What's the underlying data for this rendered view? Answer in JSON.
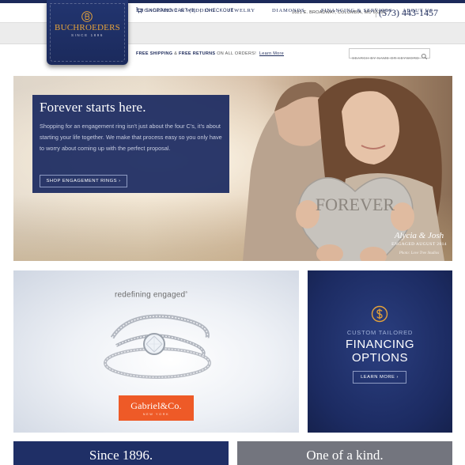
{
  "header": {
    "cart_label": "SHOPPING CART (0)",
    "checkout_label": "CHECKOUT",
    "address": "1021 E. BROADWAY, COLUMBIA, MO 65201",
    "phone": "(573) 443-1457"
  },
  "logo": {
    "name": "BUCHROEDERS",
    "since": "SINCE 1896",
    "accent_color": "#e6a33a"
  },
  "nav": {
    "items": [
      {
        "label": "ENGAGEMENT & WEDDING"
      },
      {
        "label": "JEWELRY"
      },
      {
        "label": "DIAMONDS"
      },
      {
        "label": "FINANCING & SERVICES"
      },
      {
        "label": "ABOUT US"
      }
    ]
  },
  "promo": {
    "shipping": "FREE SHIPPING",
    "amp": "&",
    "returns": "FREE RETURNS",
    "rest": "ON ALL ORDERS!",
    "link": "Learn More"
  },
  "search": {
    "placeholder": "SEARCH BY NAME OR KEYWORD"
  },
  "hero": {
    "title": "Forever starts here.",
    "body": "Shopping for an engagement ring isn't just about the four C's, it's about starting your life together. We make that process easy so you only have to worry about coming up with the perfect proposal.",
    "button": "SHOP ENGAGEMENT RINGS ›",
    "heart_text": "FOREVER",
    "caption_names": "Alycia & Josh",
    "caption_engaged": "ENGAGED AUGUST 2014",
    "caption_photo": "Photo: Love Tree Studios"
  },
  "ad_left": {
    "tagline": "redefining engaged",
    "tagline_mark": "®",
    "brand": "Gabriel&Co.",
    "brand_city": "NEW YORK"
  },
  "ad_right": {
    "subtitle": "CUSTOM TAILORED",
    "title_line1": "FINANCING",
    "title_line2": "OPTIONS",
    "button": "LEARN MORE ›"
  },
  "bottom": {
    "left_title": "Since 1896.",
    "right_title": "One of a kind."
  },
  "colors": {
    "navy": "#1c2a5a",
    "orange": "#ee5a27",
    "gold": "#e6a33a",
    "gray_panel": "#73757e"
  }
}
